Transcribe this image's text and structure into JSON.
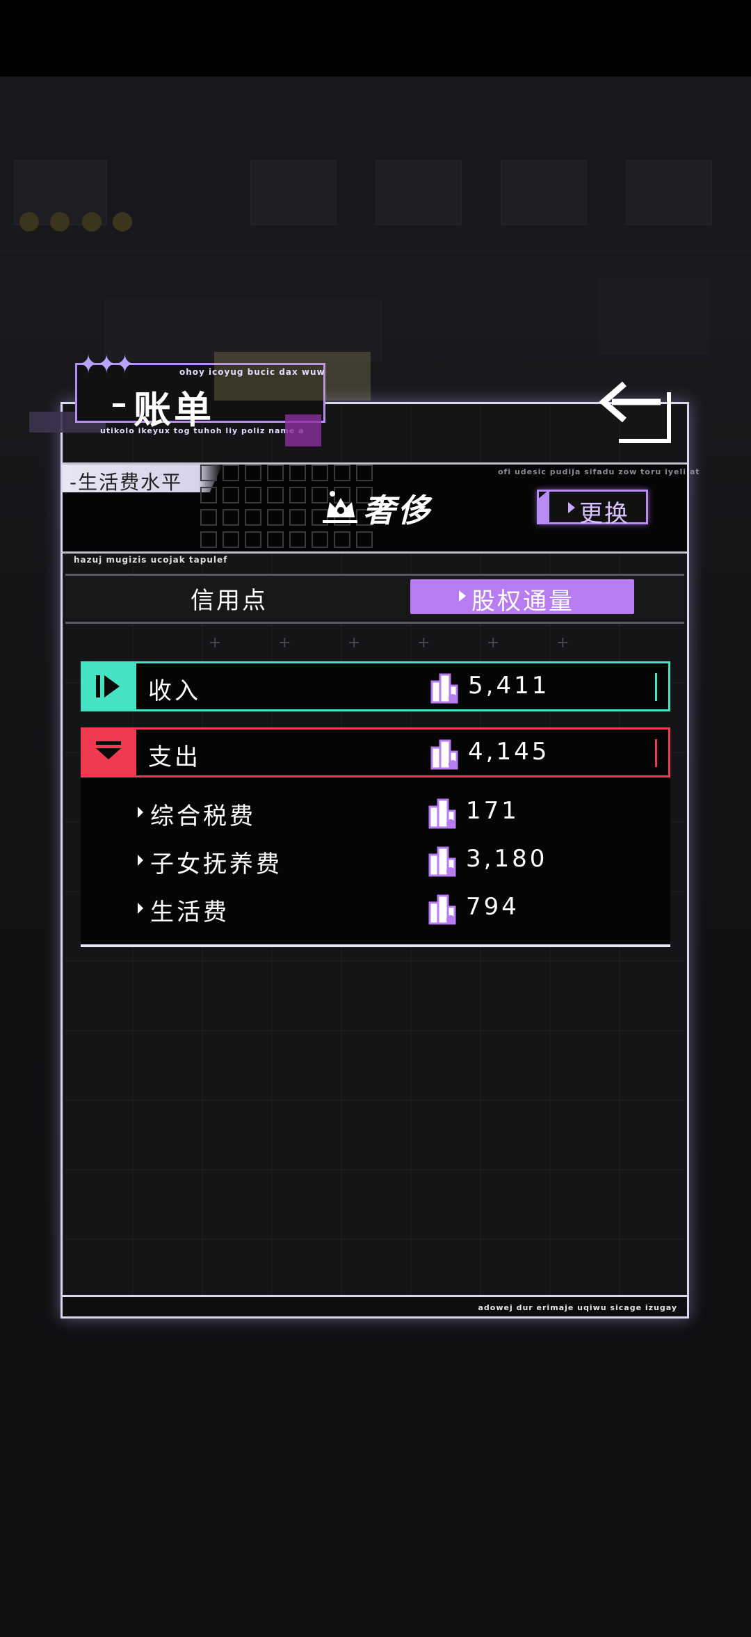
{
  "header": {
    "title": "账单",
    "sub_top": "ohoy icoyug bucic dax wuw",
    "sub_bottom": "utikolo ikeyux tog tuhoh liy poliz name a"
  },
  "living": {
    "tag": "生活费水平",
    "small_text": "ofi udesic pudija sifadu zow toru iyeli at",
    "level": "奢侈",
    "change_label": "更换"
  },
  "tabs": {
    "small_text": "hazuj mugizis ucojak tapulef",
    "credit": "信用点",
    "equity": "股权通量"
  },
  "ledger": {
    "income": {
      "label": "收入",
      "value": "5,411"
    },
    "expense": {
      "label": "支出",
      "value": "4,145"
    },
    "items": [
      {
        "label": "综合税费",
        "value": "171"
      },
      {
        "label": "子女抚养费",
        "value": "3,180"
      },
      {
        "label": "生活费",
        "value": "794"
      }
    ]
  },
  "footer": {
    "text": "adowej dur erimaje uqiwu sicage izugay"
  },
  "colors": {
    "accent": "#b77cf2",
    "income": "#44e3c4",
    "expense": "#f03a52"
  },
  "icons": [
    "back-arrow-icon",
    "crown-cat-icon",
    "equity-token-icon",
    "play-icon",
    "down-triangle-icon"
  ]
}
